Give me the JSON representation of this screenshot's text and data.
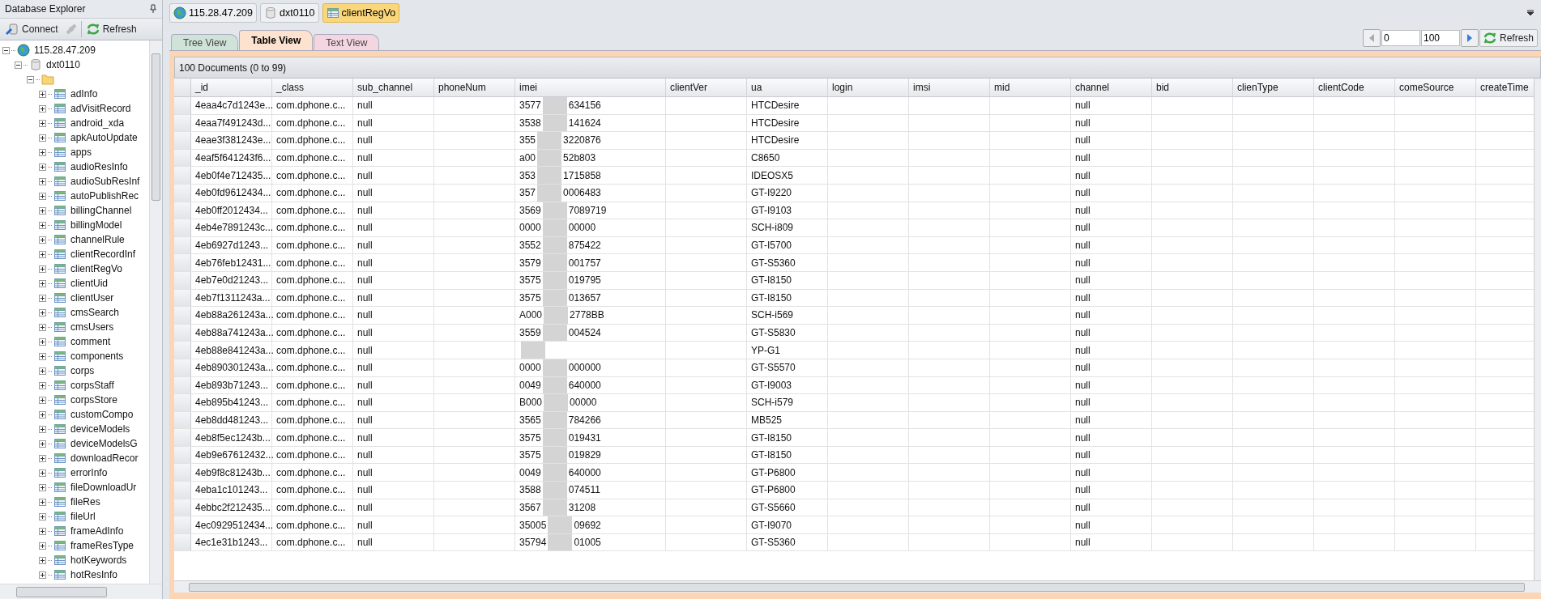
{
  "explorer": {
    "title": "Database Explorer",
    "toolbar": [
      {
        "kind": "connect",
        "label": "Connect"
      },
      {
        "kind": "disconnect"
      },
      {
        "kind": "refresh",
        "label": "Refresh"
      }
    ],
    "tree": [
      {
        "kind": "server",
        "label": "115.28.47.209",
        "expanded": true,
        "children": [
          {
            "kind": "database",
            "label": "dxt0110",
            "expanded": true,
            "children": [
              {
                "kind": "folder",
                "expanded": true,
                "children": [
                  {
                    "kind": "collection",
                    "label": "adInfo",
                    "expanded": false
                  },
                  {
                    "kind": "collection",
                    "label": "adVisitRecord",
                    "expanded": false
                  },
                  {
                    "kind": "collection",
                    "label": "android_xda",
                    "expanded": false
                  },
                  {
                    "kind": "collection",
                    "label": "apkAutoUpdate",
                    "expanded": false
                  },
                  {
                    "kind": "collection",
                    "label": "apps",
                    "expanded": false
                  },
                  {
                    "kind": "collection",
                    "label": "audioResInfo",
                    "expanded": false
                  },
                  {
                    "kind": "collection",
                    "label": "audioSubResInf",
                    "expanded": false
                  },
                  {
                    "kind": "collection",
                    "label": "autoPublishRec",
                    "expanded": false
                  },
                  {
                    "kind": "collection",
                    "label": "billingChannel",
                    "expanded": false
                  },
                  {
                    "kind": "collection",
                    "label": "billingModel",
                    "expanded": false
                  },
                  {
                    "kind": "collection",
                    "label": "channelRule",
                    "expanded": false
                  },
                  {
                    "kind": "collection",
                    "label": "clientRecordInf",
                    "expanded": false
                  },
                  {
                    "kind": "collection",
                    "label": "clientRegVo",
                    "expanded": false
                  },
                  {
                    "kind": "collection",
                    "label": "clientUid",
                    "expanded": false
                  },
                  {
                    "kind": "collection",
                    "label": "clientUser",
                    "expanded": false
                  },
                  {
                    "kind": "collection",
                    "label": "cmsSearch",
                    "expanded": false
                  },
                  {
                    "kind": "collection",
                    "label": "cmsUsers",
                    "expanded": false
                  },
                  {
                    "kind": "collection",
                    "label": "comment",
                    "expanded": false
                  },
                  {
                    "kind": "collection",
                    "label": "components",
                    "expanded": false
                  },
                  {
                    "kind": "collection",
                    "label": "corps",
                    "expanded": false
                  },
                  {
                    "kind": "collection",
                    "label": "corpsStaff",
                    "expanded": false
                  },
                  {
                    "kind": "collection",
                    "label": "corpsStore",
                    "expanded": false
                  },
                  {
                    "kind": "collection",
                    "label": "customCompo",
                    "expanded": false
                  },
                  {
                    "kind": "collection",
                    "label": "deviceModels",
                    "expanded": false
                  },
                  {
                    "kind": "collection",
                    "label": "deviceModelsG",
                    "expanded": false
                  },
                  {
                    "kind": "collection",
                    "label": "downloadRecor",
                    "expanded": false
                  },
                  {
                    "kind": "collection",
                    "label": "errorInfo",
                    "expanded": false
                  },
                  {
                    "kind": "collection",
                    "label": "fileDownloadUr",
                    "expanded": false
                  },
                  {
                    "kind": "collection",
                    "label": "fileRes",
                    "expanded": false
                  },
                  {
                    "kind": "collection",
                    "label": "fileUrl",
                    "expanded": false
                  },
                  {
                    "kind": "collection",
                    "label": "frameAdInfo",
                    "expanded": false
                  },
                  {
                    "kind": "collection",
                    "label": "frameResType",
                    "expanded": false
                  },
                  {
                    "kind": "collection",
                    "label": "hotKeywords",
                    "expanded": false
                  },
                  {
                    "kind": "collection",
                    "label": "hotResInfo",
                    "expanded": false
                  }
                ]
              }
            ]
          }
        ]
      }
    ]
  },
  "breadcrumbs": [
    {
      "kind": "server",
      "label": "115.28.47.209",
      "selected": false
    },
    {
      "kind": "database",
      "label": "dxt0110",
      "selected": false
    },
    {
      "kind": "collection",
      "label": "clientRegVo",
      "selected": true
    }
  ],
  "view_tabs": [
    {
      "label": "Tree View",
      "selected": false,
      "color": "#cfe3d8"
    },
    {
      "label": "Table View",
      "selected": true,
      "color": "#fde3cf"
    },
    {
      "label": "Text View",
      "selected": false,
      "color": "#f3d6e2"
    }
  ],
  "pager": {
    "from": "0",
    "count": "100",
    "refresh": "Refresh"
  },
  "table": {
    "caption": "100 Documents (0 to 99)",
    "columns": [
      "_id",
      "_class",
      "sub_channel",
      "phoneNum",
      "imei",
      "clientVer",
      "ua",
      "login",
      "imsi",
      "mid",
      "channel",
      "bid",
      "clienType",
      "clientCode",
      "comeSource",
      "createTime"
    ],
    "rows": [
      {
        "cells": [
          {
            "kind": "text",
            "text": "4eaa4c7d1243e..."
          },
          {
            "kind": "text",
            "text": "com.dphone.c..."
          },
          {
            "kind": "text",
            "text": "null"
          },
          {
            "kind": "blank"
          },
          {
            "kind": "redacted",
            "parts": [
              "3577",
              "634156"
            ]
          },
          {
            "kind": "blank"
          },
          {
            "kind": "text",
            "text": "HTCDesire"
          },
          {
            "kind": "blank"
          },
          {
            "kind": "blank"
          },
          {
            "kind": "blank"
          },
          {
            "kind": "text",
            "text": "null"
          },
          {
            "kind": "blank"
          },
          {
            "kind": "blank"
          },
          {
            "kind": "blank"
          },
          {
            "kind": "blank"
          },
          {
            "kind": "blank"
          }
        ]
      },
      {
        "cells": [
          {
            "kind": "text",
            "text": "4eaa7f491243d..."
          },
          {
            "kind": "text",
            "text": "com.dphone.c..."
          },
          {
            "kind": "text",
            "text": "null"
          },
          {
            "kind": "blank"
          },
          {
            "kind": "redacted",
            "parts": [
              "3538",
              "141624"
            ]
          },
          {
            "kind": "blank"
          },
          {
            "kind": "text",
            "text": "HTCDesire"
          },
          {
            "kind": "blank"
          },
          {
            "kind": "blank"
          },
          {
            "kind": "blank"
          },
          {
            "kind": "text",
            "text": "null"
          },
          {
            "kind": "blank"
          },
          {
            "kind": "blank"
          },
          {
            "kind": "blank"
          },
          {
            "kind": "blank"
          },
          {
            "kind": "blank"
          }
        ]
      },
      {
        "cells": [
          {
            "kind": "text",
            "text": "4eae3f381243e..."
          },
          {
            "kind": "text",
            "text": "com.dphone.c..."
          },
          {
            "kind": "text",
            "text": "null"
          },
          {
            "kind": "blank"
          },
          {
            "kind": "redacted",
            "parts": [
              "355",
              "3220876"
            ]
          },
          {
            "kind": "blank"
          },
          {
            "kind": "text",
            "text": "HTCDesire"
          },
          {
            "kind": "blank"
          },
          {
            "kind": "blank"
          },
          {
            "kind": "blank"
          },
          {
            "kind": "text",
            "text": "null"
          },
          {
            "kind": "blank"
          },
          {
            "kind": "blank"
          },
          {
            "kind": "blank"
          },
          {
            "kind": "blank"
          },
          {
            "kind": "blank"
          }
        ]
      },
      {
        "cells": [
          {
            "kind": "text",
            "text": "4eaf5f641243f6..."
          },
          {
            "kind": "text",
            "text": "com.dphone.c..."
          },
          {
            "kind": "text",
            "text": "null"
          },
          {
            "kind": "blank"
          },
          {
            "kind": "redacted",
            "parts": [
              "a00",
              "52b803"
            ]
          },
          {
            "kind": "blank"
          },
          {
            "kind": "text",
            "text": "C8650"
          },
          {
            "kind": "blank"
          },
          {
            "kind": "blank"
          },
          {
            "kind": "blank"
          },
          {
            "kind": "text",
            "text": "null"
          },
          {
            "kind": "blank"
          },
          {
            "kind": "blank"
          },
          {
            "kind": "blank"
          },
          {
            "kind": "blank"
          },
          {
            "kind": "blank"
          }
        ]
      },
      {
        "cells": [
          {
            "kind": "text",
            "text": "4eb0f4e712435..."
          },
          {
            "kind": "text",
            "text": "com.dphone.c..."
          },
          {
            "kind": "text",
            "text": "null"
          },
          {
            "kind": "blank"
          },
          {
            "kind": "redacted",
            "parts": [
              "353",
              "1715858"
            ]
          },
          {
            "kind": "blank"
          },
          {
            "kind": "text",
            "text": "IDEOSX5"
          },
          {
            "kind": "blank"
          },
          {
            "kind": "blank"
          },
          {
            "kind": "blank"
          },
          {
            "kind": "text",
            "text": "null"
          },
          {
            "kind": "blank"
          },
          {
            "kind": "blank"
          },
          {
            "kind": "blank"
          },
          {
            "kind": "blank"
          },
          {
            "kind": "blank"
          }
        ]
      },
      {
        "cells": [
          {
            "kind": "text",
            "text": "4eb0fd9612434..."
          },
          {
            "kind": "text",
            "text": "com.dphone.c..."
          },
          {
            "kind": "text",
            "text": "null"
          },
          {
            "kind": "blank"
          },
          {
            "kind": "redacted",
            "parts": [
              "357",
              "0006483"
            ]
          },
          {
            "kind": "blank"
          },
          {
            "kind": "text",
            "text": "GT-I9220"
          },
          {
            "kind": "blank"
          },
          {
            "kind": "blank"
          },
          {
            "kind": "blank"
          },
          {
            "kind": "text",
            "text": "null"
          },
          {
            "kind": "blank"
          },
          {
            "kind": "blank"
          },
          {
            "kind": "blank"
          },
          {
            "kind": "blank"
          },
          {
            "kind": "blank"
          }
        ]
      },
      {
        "cells": [
          {
            "kind": "text",
            "text": "4eb0ff2012434..."
          },
          {
            "kind": "text",
            "text": "com.dphone.c..."
          },
          {
            "kind": "text",
            "text": "null"
          },
          {
            "kind": "blank"
          },
          {
            "kind": "redacted",
            "parts": [
              "3569",
              "7089719"
            ]
          },
          {
            "kind": "blank"
          },
          {
            "kind": "text",
            "text": "GT-I9103"
          },
          {
            "kind": "blank"
          },
          {
            "kind": "blank"
          },
          {
            "kind": "blank"
          },
          {
            "kind": "text",
            "text": "null"
          },
          {
            "kind": "blank"
          },
          {
            "kind": "blank"
          },
          {
            "kind": "blank"
          },
          {
            "kind": "blank"
          },
          {
            "kind": "blank"
          }
        ]
      },
      {
        "cells": [
          {
            "kind": "text",
            "text": "4eb4e7891243c..."
          },
          {
            "kind": "text",
            "text": "com.dphone.c..."
          },
          {
            "kind": "text",
            "text": "null"
          },
          {
            "kind": "blank"
          },
          {
            "kind": "redacted",
            "parts": [
              "0000",
              "00000"
            ]
          },
          {
            "kind": "blank"
          },
          {
            "kind": "text",
            "text": "SCH-i809"
          },
          {
            "kind": "blank"
          },
          {
            "kind": "blank"
          },
          {
            "kind": "blank"
          },
          {
            "kind": "text",
            "text": "null"
          },
          {
            "kind": "blank"
          },
          {
            "kind": "blank"
          },
          {
            "kind": "blank"
          },
          {
            "kind": "blank"
          },
          {
            "kind": "blank"
          }
        ]
      },
      {
        "cells": [
          {
            "kind": "text",
            "text": "4eb6927d1243..."
          },
          {
            "kind": "text",
            "text": "com.dphone.c..."
          },
          {
            "kind": "text",
            "text": "null"
          },
          {
            "kind": "blank"
          },
          {
            "kind": "redacted",
            "parts": [
              "3552",
              "875422"
            ]
          },
          {
            "kind": "blank"
          },
          {
            "kind": "text",
            "text": "GT-I5700"
          },
          {
            "kind": "blank"
          },
          {
            "kind": "blank"
          },
          {
            "kind": "blank"
          },
          {
            "kind": "text",
            "text": "null"
          },
          {
            "kind": "blank"
          },
          {
            "kind": "blank"
          },
          {
            "kind": "blank"
          },
          {
            "kind": "blank"
          },
          {
            "kind": "blank"
          }
        ]
      },
      {
        "cells": [
          {
            "kind": "text",
            "text": "4eb76feb12431..."
          },
          {
            "kind": "text",
            "text": "com.dphone.c..."
          },
          {
            "kind": "text",
            "text": "null"
          },
          {
            "kind": "blank"
          },
          {
            "kind": "redacted",
            "parts": [
              "3579",
              "001757"
            ]
          },
          {
            "kind": "blank"
          },
          {
            "kind": "text",
            "text": "GT-S5360"
          },
          {
            "kind": "blank"
          },
          {
            "kind": "blank"
          },
          {
            "kind": "blank"
          },
          {
            "kind": "text",
            "text": "null"
          },
          {
            "kind": "blank"
          },
          {
            "kind": "blank"
          },
          {
            "kind": "blank"
          },
          {
            "kind": "blank"
          },
          {
            "kind": "blank"
          }
        ]
      },
      {
        "cells": [
          {
            "kind": "text",
            "text": "4eb7e0d21243..."
          },
          {
            "kind": "text",
            "text": "com.dphone.c..."
          },
          {
            "kind": "text",
            "text": "null"
          },
          {
            "kind": "blank"
          },
          {
            "kind": "redacted",
            "parts": [
              "3575",
              "019795"
            ]
          },
          {
            "kind": "blank"
          },
          {
            "kind": "text",
            "text": "GT-I8150"
          },
          {
            "kind": "blank"
          },
          {
            "kind": "blank"
          },
          {
            "kind": "blank"
          },
          {
            "kind": "text",
            "text": "null"
          },
          {
            "kind": "blank"
          },
          {
            "kind": "blank"
          },
          {
            "kind": "blank"
          },
          {
            "kind": "blank"
          },
          {
            "kind": "blank"
          }
        ]
      },
      {
        "cells": [
          {
            "kind": "text",
            "text": "4eb7f1311243a..."
          },
          {
            "kind": "text",
            "text": "com.dphone.c..."
          },
          {
            "kind": "text",
            "text": "null"
          },
          {
            "kind": "blank"
          },
          {
            "kind": "redacted",
            "parts": [
              "3575",
              "013657"
            ]
          },
          {
            "kind": "blank"
          },
          {
            "kind": "text",
            "text": "GT-I8150"
          },
          {
            "kind": "blank"
          },
          {
            "kind": "blank"
          },
          {
            "kind": "blank"
          },
          {
            "kind": "text",
            "text": "null"
          },
          {
            "kind": "blank"
          },
          {
            "kind": "blank"
          },
          {
            "kind": "blank"
          },
          {
            "kind": "blank"
          },
          {
            "kind": "blank"
          }
        ]
      },
      {
        "cells": [
          {
            "kind": "text",
            "text": "4eb88a261243a..."
          },
          {
            "kind": "text",
            "text": "com.dphone.c..."
          },
          {
            "kind": "text",
            "text": "null"
          },
          {
            "kind": "blank"
          },
          {
            "kind": "redacted",
            "parts": [
              "A000",
              "2778BB"
            ]
          },
          {
            "kind": "blank"
          },
          {
            "kind": "text",
            "text": "SCH-i569"
          },
          {
            "kind": "blank"
          },
          {
            "kind": "blank"
          },
          {
            "kind": "blank"
          },
          {
            "kind": "text",
            "text": "null"
          },
          {
            "kind": "blank"
          },
          {
            "kind": "blank"
          },
          {
            "kind": "blank"
          },
          {
            "kind": "blank"
          },
          {
            "kind": "blank"
          }
        ]
      },
      {
        "cells": [
          {
            "kind": "text",
            "text": "4eb88a741243a..."
          },
          {
            "kind": "text",
            "text": "com.dphone.c..."
          },
          {
            "kind": "text",
            "text": "null"
          },
          {
            "kind": "blank"
          },
          {
            "kind": "redacted",
            "parts": [
              "3559",
              "004524"
            ]
          },
          {
            "kind": "blank"
          },
          {
            "kind": "text",
            "text": "GT-S5830"
          },
          {
            "kind": "blank"
          },
          {
            "kind": "blank"
          },
          {
            "kind": "blank"
          },
          {
            "kind": "text",
            "text": "null"
          },
          {
            "kind": "blank"
          },
          {
            "kind": "blank"
          },
          {
            "kind": "blank"
          },
          {
            "kind": "blank"
          },
          {
            "kind": "blank"
          }
        ]
      },
      {
        "cells": [
          {
            "kind": "text",
            "text": "4eb88e841243a..."
          },
          {
            "kind": "text",
            "text": "com.dphone.c..."
          },
          {
            "kind": "text",
            "text": "null"
          },
          {
            "kind": "blank"
          },
          {
            "kind": "redacted"
          },
          {
            "kind": "blank"
          },
          {
            "kind": "text",
            "text": "YP-G1"
          },
          {
            "kind": "blank"
          },
          {
            "kind": "blank"
          },
          {
            "kind": "blank"
          },
          {
            "kind": "text",
            "text": "null"
          },
          {
            "kind": "blank"
          },
          {
            "kind": "blank"
          },
          {
            "kind": "blank"
          },
          {
            "kind": "blank"
          },
          {
            "kind": "blank"
          }
        ]
      },
      {
        "cells": [
          {
            "kind": "text",
            "text": "4eb890301243a..."
          },
          {
            "kind": "text",
            "text": "com.dphone.c..."
          },
          {
            "kind": "text",
            "text": "null"
          },
          {
            "kind": "blank"
          },
          {
            "kind": "redacted",
            "parts": [
              "0000",
              "000000"
            ]
          },
          {
            "kind": "blank"
          },
          {
            "kind": "text",
            "text": "GT-S5570"
          },
          {
            "kind": "blank"
          },
          {
            "kind": "blank"
          },
          {
            "kind": "blank"
          },
          {
            "kind": "text",
            "text": "null"
          },
          {
            "kind": "blank"
          },
          {
            "kind": "blank"
          },
          {
            "kind": "blank"
          },
          {
            "kind": "blank"
          },
          {
            "kind": "blank"
          }
        ]
      },
      {
        "cells": [
          {
            "kind": "text",
            "text": "4eb893b71243..."
          },
          {
            "kind": "text",
            "text": "com.dphone.c..."
          },
          {
            "kind": "text",
            "text": "null"
          },
          {
            "kind": "blank"
          },
          {
            "kind": "redacted",
            "parts": [
              "0049",
              "640000"
            ]
          },
          {
            "kind": "blank"
          },
          {
            "kind": "text",
            "text": "GT-I9003"
          },
          {
            "kind": "blank"
          },
          {
            "kind": "blank"
          },
          {
            "kind": "blank"
          },
          {
            "kind": "text",
            "text": "null"
          },
          {
            "kind": "blank"
          },
          {
            "kind": "blank"
          },
          {
            "kind": "blank"
          },
          {
            "kind": "blank"
          },
          {
            "kind": "blank"
          }
        ]
      },
      {
        "cells": [
          {
            "kind": "text",
            "text": "4eb895b41243..."
          },
          {
            "kind": "text",
            "text": "com.dphone.c..."
          },
          {
            "kind": "text",
            "text": "null"
          },
          {
            "kind": "blank"
          },
          {
            "kind": "redacted",
            "parts": [
              "B000",
              "00000"
            ]
          },
          {
            "kind": "blank"
          },
          {
            "kind": "text",
            "text": "SCH-i579"
          },
          {
            "kind": "blank"
          },
          {
            "kind": "blank"
          },
          {
            "kind": "blank"
          },
          {
            "kind": "text",
            "text": "null"
          },
          {
            "kind": "blank"
          },
          {
            "kind": "blank"
          },
          {
            "kind": "blank"
          },
          {
            "kind": "blank"
          },
          {
            "kind": "blank"
          }
        ]
      },
      {
        "cells": [
          {
            "kind": "text",
            "text": "4eb8dd481243..."
          },
          {
            "kind": "text",
            "text": "com.dphone.c..."
          },
          {
            "kind": "text",
            "text": "null"
          },
          {
            "kind": "blank"
          },
          {
            "kind": "redacted",
            "parts": [
              "3565",
              "784266"
            ]
          },
          {
            "kind": "blank"
          },
          {
            "kind": "text",
            "text": "MB525"
          },
          {
            "kind": "blank"
          },
          {
            "kind": "blank"
          },
          {
            "kind": "blank"
          },
          {
            "kind": "text",
            "text": "null"
          },
          {
            "kind": "blank"
          },
          {
            "kind": "blank"
          },
          {
            "kind": "blank"
          },
          {
            "kind": "blank"
          },
          {
            "kind": "blank"
          }
        ]
      },
      {
        "cells": [
          {
            "kind": "text",
            "text": "4eb8f5ec1243b..."
          },
          {
            "kind": "text",
            "text": "com.dphone.c..."
          },
          {
            "kind": "text",
            "text": "null"
          },
          {
            "kind": "blank"
          },
          {
            "kind": "redacted",
            "parts": [
              "3575",
              "019431"
            ]
          },
          {
            "kind": "blank"
          },
          {
            "kind": "text",
            "text": "GT-I8150"
          },
          {
            "kind": "blank"
          },
          {
            "kind": "blank"
          },
          {
            "kind": "blank"
          },
          {
            "kind": "text",
            "text": "null"
          },
          {
            "kind": "blank"
          },
          {
            "kind": "blank"
          },
          {
            "kind": "blank"
          },
          {
            "kind": "blank"
          },
          {
            "kind": "blank"
          }
        ]
      },
      {
        "cells": [
          {
            "kind": "text",
            "text": "4eb9e67612432..."
          },
          {
            "kind": "text",
            "text": "com.dphone.c..."
          },
          {
            "kind": "text",
            "text": "null"
          },
          {
            "kind": "blank"
          },
          {
            "kind": "redacted",
            "parts": [
              "3575",
              "019829"
            ]
          },
          {
            "kind": "blank"
          },
          {
            "kind": "text",
            "text": "GT-I8150"
          },
          {
            "kind": "blank"
          },
          {
            "kind": "blank"
          },
          {
            "kind": "blank"
          },
          {
            "kind": "text",
            "text": "null"
          },
          {
            "kind": "blank"
          },
          {
            "kind": "blank"
          },
          {
            "kind": "blank"
          },
          {
            "kind": "blank"
          },
          {
            "kind": "blank"
          }
        ]
      },
      {
        "cells": [
          {
            "kind": "text",
            "text": "4eb9f8c81243b..."
          },
          {
            "kind": "text",
            "text": "com.dphone.c..."
          },
          {
            "kind": "text",
            "text": "null"
          },
          {
            "kind": "blank"
          },
          {
            "kind": "redacted",
            "parts": [
              "0049",
              "640000"
            ]
          },
          {
            "kind": "blank"
          },
          {
            "kind": "text",
            "text": "GT-P6800"
          },
          {
            "kind": "blank"
          },
          {
            "kind": "blank"
          },
          {
            "kind": "blank"
          },
          {
            "kind": "text",
            "text": "null"
          },
          {
            "kind": "blank"
          },
          {
            "kind": "blank"
          },
          {
            "kind": "blank"
          },
          {
            "kind": "blank"
          },
          {
            "kind": "blank"
          }
        ]
      },
      {
        "cells": [
          {
            "kind": "text",
            "text": "4eba1c101243..."
          },
          {
            "kind": "text",
            "text": "com.dphone.c..."
          },
          {
            "kind": "text",
            "text": "null"
          },
          {
            "kind": "blank"
          },
          {
            "kind": "redacted",
            "parts": [
              "3588",
              "074511"
            ]
          },
          {
            "kind": "blank"
          },
          {
            "kind": "text",
            "text": "GT-P6800"
          },
          {
            "kind": "blank"
          },
          {
            "kind": "blank"
          },
          {
            "kind": "blank"
          },
          {
            "kind": "text",
            "text": "null"
          },
          {
            "kind": "blank"
          },
          {
            "kind": "blank"
          },
          {
            "kind": "blank"
          },
          {
            "kind": "blank"
          },
          {
            "kind": "blank"
          }
        ]
      },
      {
        "cells": [
          {
            "kind": "text",
            "text": "4ebbc2f212435..."
          },
          {
            "kind": "text",
            "text": "com.dphone.c..."
          },
          {
            "kind": "text",
            "text": "null"
          },
          {
            "kind": "blank"
          },
          {
            "kind": "redacted",
            "parts": [
              "3567",
              "31208"
            ]
          },
          {
            "kind": "blank"
          },
          {
            "kind": "text",
            "text": "GT-S5660"
          },
          {
            "kind": "blank"
          },
          {
            "kind": "blank"
          },
          {
            "kind": "blank"
          },
          {
            "kind": "text",
            "text": "null"
          },
          {
            "kind": "blank"
          },
          {
            "kind": "blank"
          },
          {
            "kind": "blank"
          },
          {
            "kind": "blank"
          },
          {
            "kind": "blank"
          }
        ]
      },
      {
        "cells": [
          {
            "kind": "text",
            "text": "4ec0929512434..."
          },
          {
            "kind": "text",
            "text": "com.dphone.c..."
          },
          {
            "kind": "text",
            "text": "null"
          },
          {
            "kind": "blank"
          },
          {
            "kind": "redacted",
            "parts": [
              "35005",
              "09692"
            ]
          },
          {
            "kind": "blank"
          },
          {
            "kind": "text",
            "text": "GT-I9070"
          },
          {
            "kind": "blank"
          },
          {
            "kind": "blank"
          },
          {
            "kind": "blank"
          },
          {
            "kind": "text",
            "text": "null"
          },
          {
            "kind": "blank"
          },
          {
            "kind": "blank"
          },
          {
            "kind": "blank"
          },
          {
            "kind": "blank"
          },
          {
            "kind": "blank"
          }
        ]
      },
      {
        "cells": [
          {
            "kind": "text",
            "text": "4ec1e31b1243..."
          },
          {
            "kind": "text",
            "text": "com.dphone.c..."
          },
          {
            "kind": "text",
            "text": "null"
          },
          {
            "kind": "blank"
          },
          {
            "kind": "redacted",
            "parts": [
              "35794",
              "01005"
            ]
          },
          {
            "kind": "blank"
          },
          {
            "kind": "text",
            "text": "GT-S5360"
          },
          {
            "kind": "blank"
          },
          {
            "kind": "blank"
          },
          {
            "kind": "blank"
          },
          {
            "kind": "text",
            "text": "null"
          },
          {
            "kind": "blank"
          },
          {
            "kind": "blank"
          },
          {
            "kind": "blank"
          },
          {
            "kind": "blank"
          },
          {
            "kind": "blank"
          }
        ]
      }
    ]
  }
}
